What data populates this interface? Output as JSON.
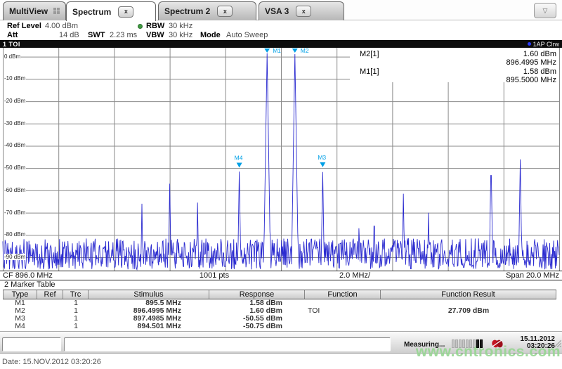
{
  "ui": {
    "close_glyph": "x",
    "dropdown_glyph": "▽"
  },
  "colors": {
    "trace": "#2b2bd0",
    "marker": "#00a0e6",
    "marker_text": "#1b85c8",
    "grid": "#8a8a8a",
    "rbw_dot_green": "#3f9b41",
    "trace_dot_blue": "#2a3bff",
    "red_icon": "#c41422",
    "watermark_green": "#96d68f"
  },
  "tabs": [
    {
      "label": "MultiView",
      "active": false,
      "closable": false,
      "has_grid_icon": true
    },
    {
      "label": "Spectrum",
      "active": true,
      "closable": true
    },
    {
      "label": "Spectrum 2",
      "active": false,
      "closable": true
    },
    {
      "label": "VSA 3",
      "active": false,
      "closable": true
    }
  ],
  "settings": {
    "ref_level_label": "Ref Level",
    "ref_level": "4.00 dBm",
    "att_label": "Att",
    "att": "14 dB",
    "swt_label": "SWT",
    "swt": "2.23 ms",
    "rbw_label": "RBW",
    "rbw": "30 kHz",
    "vbw_label": "VBW",
    "vbw": "30 kHz",
    "mode_label": "Mode",
    "mode": "Auto Sweep"
  },
  "channel_bar": {
    "title": "1 TOI",
    "trace_label": "1AP Clrw"
  },
  "marker_info": [
    {
      "name": "M2[1]",
      "level": "1.60 dBm",
      "freq": "896.4995 MHz"
    },
    {
      "name": "M1[1]",
      "level": "1.58 dBm",
      "freq": "895.5000 MHz"
    }
  ],
  "axis_bar": {
    "cf": "CF 896.0 MHz",
    "points": "1001 pts",
    "per_div": "2.0 MHz/",
    "span": "Span 20.0 MHz"
  },
  "marker_table": {
    "title": "2 Marker Table",
    "headers": [
      "Type",
      "Ref",
      "Trc",
      "Stimulus",
      "Response",
      "Function",
      "Function Result"
    ],
    "rows": [
      [
        "M1",
        "",
        "1",
        "895.5 MHz",
        "1.58 dBm",
        "",
        ""
      ],
      [
        "M2",
        "",
        "1",
        "896.4995 MHz",
        "1.60 dBm",
        "TOI",
        "27.709 dBm"
      ],
      [
        "M3",
        "",
        "1",
        "897.4985 MHz",
        "-50.55 dBm",
        "",
        ""
      ],
      [
        "M4",
        "",
        "1",
        "894.501 MHz",
        "-50.75 dBm",
        "",
        ""
      ]
    ]
  },
  "status_bar": {
    "measuring": "Measuring...",
    "progress_segments": 9,
    "progress_filled": 2,
    "date": "15.11.2012",
    "time": "03:20:26"
  },
  "footer": {
    "date_line": "Date: 15.NOV.2012  03:20:26",
    "watermark": "www.cntronics.com"
  },
  "chart_data": {
    "type": "line",
    "title": "1 TOI",
    "x_axis": {
      "center_mhz": 896.0,
      "span_mhz": 20.0,
      "per_div_mhz": 2.0,
      "start_mhz": 886.0,
      "end_mhz": 906.0,
      "points": 1001,
      "grid_divisions": 10
    },
    "y_axis": {
      "ref_level_dbm": 4.0,
      "top_dbm": 4,
      "bottom_dbm": -96,
      "db_per_div": 10,
      "tick_values": [
        0,
        -10,
        -20,
        -30,
        -40,
        -50,
        -60,
        -70,
        -80,
        -90
      ],
      "tick_labels": [
        "0 dBm",
        "-10 dBm",
        "-20 dBm",
        "-30 dBm",
        "-40 dBm",
        "-50 dBm",
        "-60 dBm",
        "-70 dBm",
        "-80 dBm",
        "-90 dBm"
      ]
    },
    "noise_floor_dbm": {
      "min": -96,
      "max": -81
    },
    "peaks": [
      {
        "freq_mhz": 891.0,
        "level_dbm": -66.0
      },
      {
        "freq_mhz": 892.0,
        "level_dbm": -57.0
      },
      {
        "freq_mhz": 893.0,
        "level_dbm": -65.5
      },
      {
        "freq_mhz": 894.501,
        "level_dbm": -50.75
      },
      {
        "freq_mhz": 895.5,
        "level_dbm": 1.58
      },
      {
        "freq_mhz": 896.4995,
        "level_dbm": 1.6
      },
      {
        "freq_mhz": 897.4985,
        "level_dbm": -50.55
      },
      {
        "freq_mhz": 898.8,
        "level_dbm": -77.0
      },
      {
        "freq_mhz": 899.35,
        "level_dbm": -68.0
      },
      {
        "freq_mhz": 900.4,
        "level_dbm": -61.5
      },
      {
        "freq_mhz": 901.3,
        "level_dbm": -70.0
      },
      {
        "freq_mhz": 903.55,
        "level_dbm": -45.3
      },
      {
        "freq_mhz": 904.6,
        "level_dbm": -46.1
      }
    ],
    "markers": [
      {
        "id": "M1",
        "freq_mhz": 895.5,
        "level_dbm": 1.58,
        "label_side": "right"
      },
      {
        "id": "M2",
        "freq_mhz": 896.4995,
        "level_dbm": 1.6,
        "label_side": "right"
      },
      {
        "id": "M3",
        "freq_mhz": 897.4985,
        "level_dbm": -50.55,
        "label_side": "above"
      },
      {
        "id": "M4",
        "freq_mhz": 894.501,
        "level_dbm": -50.75,
        "label_side": "above"
      }
    ],
    "trace": {
      "name": "1AP Clrw",
      "legend_position": "top-right",
      "grid": true
    }
  }
}
